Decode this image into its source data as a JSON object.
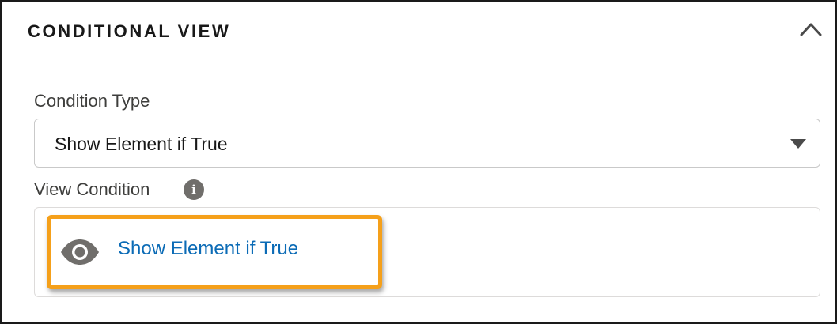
{
  "section": {
    "title": "CONDITIONAL VIEW"
  },
  "condition_type": {
    "label": "Condition Type",
    "selected": "Show Element if True"
  },
  "view_condition": {
    "label": "View Condition",
    "info_glyph": "i",
    "link_text": "Show Element if True"
  },
  "icons": {
    "collapse": "chevron-up-icon",
    "dropdown": "caret-down-icon",
    "info": "info-icon",
    "view": "eye-icon"
  },
  "colors": {
    "link": "#0b6bb6",
    "highlight": "#f5a01a",
    "icon_gray": "#706e6b"
  }
}
